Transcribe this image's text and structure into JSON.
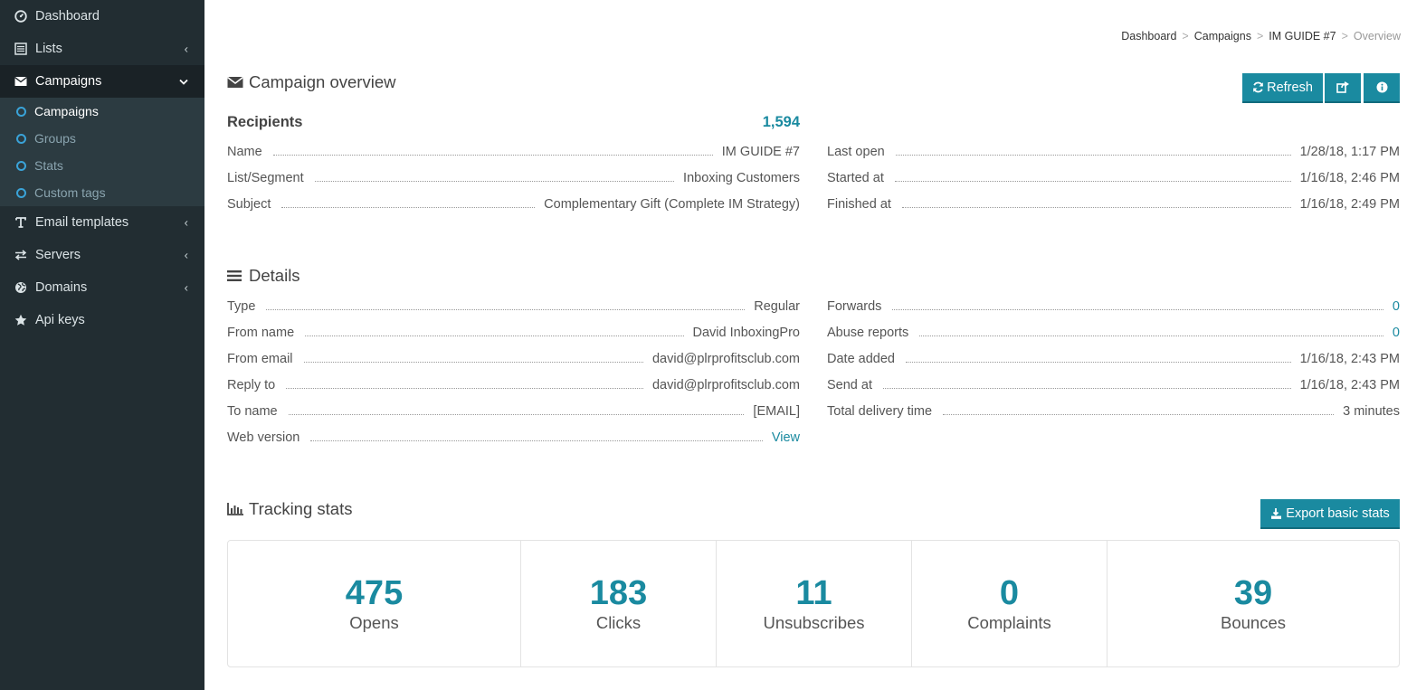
{
  "sidebar": {
    "items": [
      {
        "label": "Dashboard",
        "icon": "dashboard-icon"
      },
      {
        "label": "Lists",
        "icon": "list-icon"
      },
      {
        "label": "Campaigns",
        "icon": "envelope-icon"
      },
      {
        "label": "Email templates",
        "icon": "text-icon"
      },
      {
        "label": "Servers",
        "icon": "exchange-icon"
      },
      {
        "label": "Domains",
        "icon": "globe-icon"
      },
      {
        "label": "Api keys",
        "icon": "star-icon"
      }
    ],
    "submenu": [
      {
        "label": "Campaigns"
      },
      {
        "label": "Groups"
      },
      {
        "label": "Stats"
      },
      {
        "label": "Custom tags"
      }
    ]
  },
  "breadcrumb": {
    "items": [
      "Dashboard",
      "Campaigns",
      "IM GUIDE #7"
    ],
    "current": "Overview",
    "sep": ">"
  },
  "overview": {
    "title": "Campaign overview",
    "refresh_label": "Refresh",
    "recipients_label": "Recipients",
    "recipients_value": "1,594",
    "left": [
      {
        "k": "Name",
        "v": "IM GUIDE #7"
      },
      {
        "k": "List/Segment",
        "v": "Inboxing Customers"
      },
      {
        "k": "Subject",
        "v": "Complementary Gift (Complete IM Strategy)"
      }
    ],
    "right": [
      {
        "k": "Last open",
        "v": "1/28/18, 1:17 PM"
      },
      {
        "k": "Started at",
        "v": "1/16/18, 2:46 PM"
      },
      {
        "k": "Finished at",
        "v": "1/16/18, 2:49 PM"
      }
    ]
  },
  "details": {
    "title": "Details",
    "left": [
      {
        "k": "Type",
        "v": "Regular"
      },
      {
        "k": "From name",
        "v": "David InboxingPro"
      },
      {
        "k": "From email",
        "v": "david@plrprofitsclub.com"
      },
      {
        "k": "Reply to",
        "v": "david@plrprofitsclub.com"
      },
      {
        "k": "To name",
        "v": "[EMAIL]"
      },
      {
        "k": "Web version",
        "v": "View"
      }
    ],
    "right": [
      {
        "k": "Forwards",
        "v": "0"
      },
      {
        "k": "Abuse reports",
        "v": "0"
      },
      {
        "k": "Date added",
        "v": "1/16/18, 2:43 PM"
      },
      {
        "k": "Send at",
        "v": "1/16/18, 2:43 PM"
      },
      {
        "k": "Total delivery time",
        "v": "3 minutes"
      }
    ]
  },
  "tracking": {
    "title": "Tracking stats",
    "export_label": "Export basic stats",
    "stats": [
      {
        "value": "475",
        "label": "Opens"
      },
      {
        "value": "183",
        "label": "Clicks"
      },
      {
        "value": "11",
        "label": "Unsubscribes"
      },
      {
        "value": "0",
        "label": "Complaints"
      },
      {
        "value": "39",
        "label": "Bounces"
      }
    ]
  },
  "colors": {
    "sidebar_bg": "#222d32",
    "accent": "#1a8aa0",
    "active_bg": "#1a2226"
  }
}
